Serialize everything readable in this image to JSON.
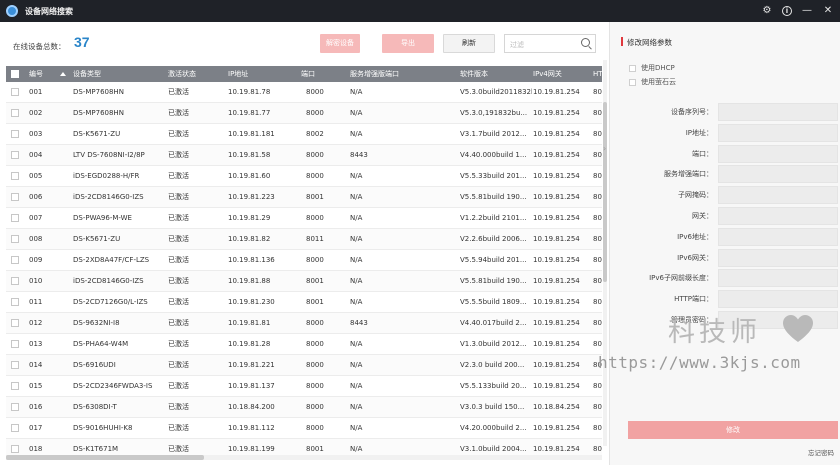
{
  "window": {
    "title": "设备网络搜索"
  },
  "toolbar": {
    "count_label": "在线设备总数：",
    "count": "37",
    "activate_label": "解密设备",
    "export_label": "导出",
    "refresh_label": "刷新",
    "search_placeholder": "过滤"
  },
  "table": {
    "headers": [
      "编号",
      "设备类型",
      "激活状态",
      "IP地址",
      "端口",
      "服务增强版端口",
      "软件版本",
      "IPv4网关",
      "HT"
    ],
    "rows": [
      [
        "001",
        "DS-MP7608HN",
        "已激活",
        "10.19.81.78",
        "8000",
        "N/A",
        "V5.3.0build2011832bu...",
        "10.19.81.254",
        "80"
      ],
      [
        "002",
        "DS-MP7608HN",
        "已激活",
        "10.19.81.77",
        "8000",
        "N/A",
        "V5.3.0,191832bu...",
        "10.19.81.254",
        "80"
      ],
      [
        "003",
        "DS-K5671-ZU",
        "已激活",
        "10.19.81.181",
        "8002",
        "N/A",
        "V3.1.7build 2012...",
        "10.19.81.254",
        "80"
      ],
      [
        "004",
        "LTV DS-7608NI-I2/8P",
        "已激活",
        "10.19.81.58",
        "8000",
        "8443",
        "V4.40.000build 1...",
        "10.19.81.254",
        "80"
      ],
      [
        "005",
        "iDS-EGD0288-H/FR",
        "已激活",
        "10.19.81.60",
        "8000",
        "N/A",
        "V5.5.33build 201...",
        "10.19.81.254",
        "80"
      ],
      [
        "006",
        "iDS-2CD8146G0-IZS",
        "已激活",
        "10.19.81.223",
        "8001",
        "N/A",
        "V5.5.81build 190...",
        "10.19.81.254",
        "80"
      ],
      [
        "007",
        "DS-PWA96-M-WE",
        "已激活",
        "10.19.81.29",
        "8000",
        "N/A",
        "V1.2.2build 2101...",
        "10.19.81.254",
        "80"
      ],
      [
        "008",
        "DS-K5671-ZU",
        "已激活",
        "10.19.81.82",
        "8011",
        "N/A",
        "V2.2.6build 2006...",
        "10.19.81.254",
        "80"
      ],
      [
        "009",
        "DS-2XD8A47F/CF-LZS",
        "已激活",
        "10.19.81.136",
        "8000",
        "N/A",
        "V5.5.94build 201...",
        "10.19.81.254",
        "80"
      ],
      [
        "010",
        "iDS-2CD8146G0-IZS",
        "已激活",
        "10.19.81.88",
        "8001",
        "N/A",
        "V5.5.81build 190...",
        "10.19.81.254",
        "80"
      ],
      [
        "011",
        "DS-2CD7126G0/L-IZS",
        "已激活",
        "10.19.81.230",
        "8001",
        "N/A",
        "V5.5.5build 1809...",
        "10.19.81.254",
        "80"
      ],
      [
        "012",
        "DS-9632NI-I8",
        "已激活",
        "10.19.81.81",
        "8000",
        "8443",
        "V4.40.017build 2...",
        "10.19.81.254",
        "80"
      ],
      [
        "013",
        "DS-PHA64-W4M",
        "已激活",
        "10.19.81.28",
        "8000",
        "N/A",
        "V1.3.0build 2012...",
        "10.19.81.254",
        "80"
      ],
      [
        "014",
        "DS-6916UDI",
        "已激活",
        "10.19.81.221",
        "8000",
        "N/A",
        "V2.3.0 build 200...",
        "10.19.81.254",
        "80"
      ],
      [
        "015",
        "DS-2CD2346FWDA3-IS",
        "已激活",
        "10.19.81.137",
        "8000",
        "N/A",
        "V5.5.133build 20...",
        "10.19.81.254",
        "80"
      ],
      [
        "016",
        "DS-6308DI-T",
        "已激活",
        "10.18.84.200",
        "8000",
        "N/A",
        "V3.0.3 build 150...",
        "10.18.84.254",
        "80"
      ],
      [
        "017",
        "DS-9016HUHI-K8",
        "已激活",
        "10.19.81.112",
        "8000",
        "N/A",
        "V4.20.000build 2...",
        "10.19.81.254",
        "80"
      ],
      [
        "018",
        "DS-K1T671M",
        "已激活",
        "10.19.81.199",
        "8001",
        "N/A",
        "V3.1.0build 2004...",
        "10.19.81.254",
        "80"
      ]
    ]
  },
  "panel": {
    "title": "修改网络参数",
    "use_dhcp": "使用DHCP",
    "use_cloud": "使用萤石云",
    "fields": [
      "设备序列号：",
      "IP地址：",
      "端口：",
      "服务增强端口：",
      "子网掩码：",
      "网关：",
      "IPv6地址：",
      "IPv6网关：",
      "IPv6子网前缀长度：",
      "HTTP端口：",
      "管理员密码："
    ],
    "submit_label": "修改",
    "forgot_label": "忘记密码"
  },
  "watermark": {
    "text": "科技师",
    "url": "https://www.3kjs.com"
  }
}
